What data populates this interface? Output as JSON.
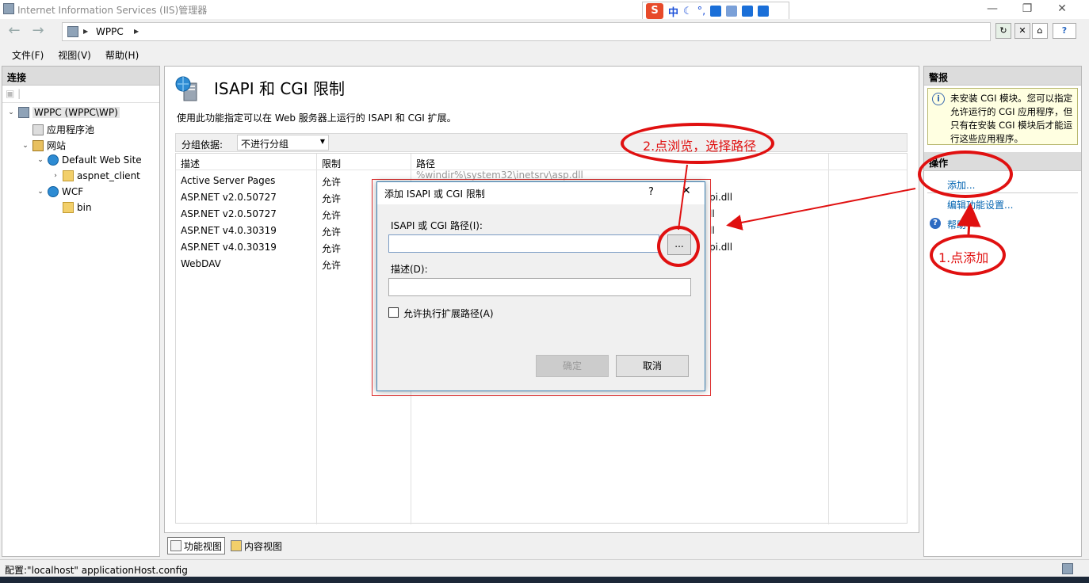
{
  "window": {
    "title": "Internet Information Services (IIS)管理器",
    "minimize": "—",
    "restore": "❐",
    "close": "✕"
  },
  "ime": {
    "logo": "S",
    "mode": "中",
    "moon": "☾",
    "punct": "°,"
  },
  "nav": {
    "back": "←",
    "forward": "→",
    "breadcrumb": "WPPC",
    "help_icon": "?"
  },
  "menu": [
    "文件(F)",
    "视图(V)",
    "帮助(H)"
  ],
  "connections": {
    "header": "连接",
    "tree": [
      {
        "label": "WPPC (WPPC\\WP)",
        "icon": "server-icon",
        "twisty": "⌄",
        "selected": true
      },
      {
        "label": "应用程序池",
        "icon": "app-pool-icon",
        "twisty": ""
      },
      {
        "label": "网站",
        "icon": "sites-icon",
        "twisty": "⌄"
      },
      {
        "label": "Default Web Site",
        "icon": "globe-icon",
        "twisty": "⌄"
      },
      {
        "label": "aspnet_client",
        "icon": "folder-icon",
        "twisty": "›"
      },
      {
        "label": "WCF",
        "icon": "globe-icon",
        "twisty": "⌄"
      },
      {
        "label": "bin",
        "icon": "folder-icon",
        "twisty": ""
      }
    ]
  },
  "feature": {
    "title": "ISAPI 和 CGI 限制",
    "description": "使用此功能指定可以在 Web 服务器上运行的 ISAPI 和 CGI 扩展。",
    "group_label": "分组依据:",
    "group_value": "不进行分组",
    "columns": [
      "描述",
      "限制",
      "路径"
    ],
    "rows": [
      {
        "desc": "Active Server Pages",
        "restriction": "允许",
        "path": "%windir%\\system32\\inetsrv\\asp.dll"
      },
      {
        "desc": "ASP.NET v2.0.50727",
        "restriction": "允许",
        "path": "pi.dll"
      },
      {
        "desc": "ASP.NET v2.0.50727",
        "restriction": "允许",
        "path": "ll"
      },
      {
        "desc": "ASP.NET v4.0.30319",
        "restriction": "允许",
        "path": "ll"
      },
      {
        "desc": "ASP.NET v4.0.30319",
        "restriction": "允许",
        "path": "pi.dll"
      },
      {
        "desc": "WebDAV",
        "restriction": "允许",
        "path": ""
      }
    ],
    "tabs": {
      "features": "功能视图",
      "content": "内容视图"
    }
  },
  "actions": {
    "header": "警报",
    "alert": "未安装 CGI 模块。您可以指定允许运行的 CGI 应用程序，但只有在安装 CGI 模块后才能运行这些应用程序。",
    "ops_header": "操作",
    "add": "添加...",
    "edit_settings": "编辑功能设置...",
    "help": "帮助"
  },
  "dialog": {
    "title": "添加 ISAPI 或 CGI 限制",
    "help": "?",
    "close": "✕",
    "path_label": "ISAPI 或 CGI 路径(I):",
    "path_value": "",
    "browse": "...",
    "desc_label": "描述(D):",
    "desc_value": "",
    "checkbox_label": "允许执行扩展路径(A)",
    "ok": "确定",
    "cancel": "取消"
  },
  "annotations": {
    "step1": "1.点添加",
    "step2": "2.点浏览，选择路径"
  },
  "status": {
    "text": "配置:\"localhost\" applicationHost.config"
  },
  "colors": {
    "annotation_red": "#e01010",
    "link_blue": "#0063b1",
    "alert_bg": "#ffffe1"
  }
}
